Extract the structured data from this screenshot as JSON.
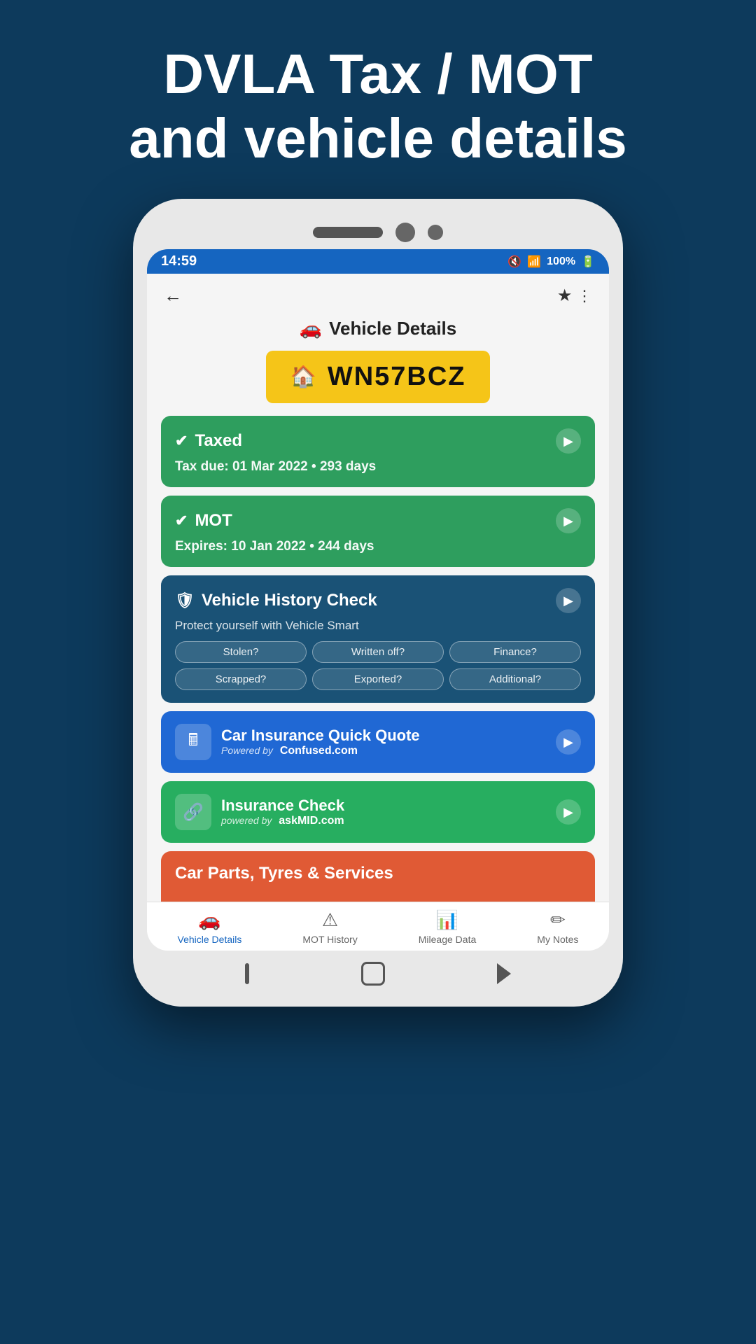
{
  "header": {
    "line1": "DVLA Tax / MOT",
    "line2": "and vehicle details"
  },
  "status_bar": {
    "time": "14:59",
    "battery": "100%"
  },
  "app_bar": {
    "back_label": "←",
    "share_label": "⋮"
  },
  "page_title": "Vehicle Details",
  "reg_plate": "WN57BCZ",
  "tax_card": {
    "title": "Taxed",
    "subtitle": "Tax due: 01 Mar 2022 • 293 days"
  },
  "mot_card": {
    "title": "MOT",
    "subtitle": "Expires: 10 Jan 2022 • 244 days"
  },
  "history_card": {
    "title": "Vehicle History Check",
    "description": "Protect yourself with Vehicle Smart",
    "badges": [
      "Stolen?",
      "Written off?",
      "Finance?",
      "Scrapped?",
      "Exported?",
      "Additional?"
    ]
  },
  "insurance_quote_card": {
    "title": "Car Insurance Quick Quote",
    "powered_by": "Powered by",
    "brand": "Confused.com"
  },
  "insurance_check_card": {
    "title": "Insurance Check",
    "powered_by": "powered by",
    "brand": "askMID.com"
  },
  "parts_card": {
    "title": "Car Parts, Tyres & Services"
  },
  "bottom_nav": {
    "items": [
      {
        "label": "Vehicle Details",
        "icon": "🚗",
        "active": true
      },
      {
        "label": "MOT History",
        "icon": "⚠",
        "active": false
      },
      {
        "label": "Mileage Data",
        "icon": "📊",
        "active": false
      },
      {
        "label": "My Notes",
        "icon": "✏",
        "active": false
      }
    ]
  }
}
